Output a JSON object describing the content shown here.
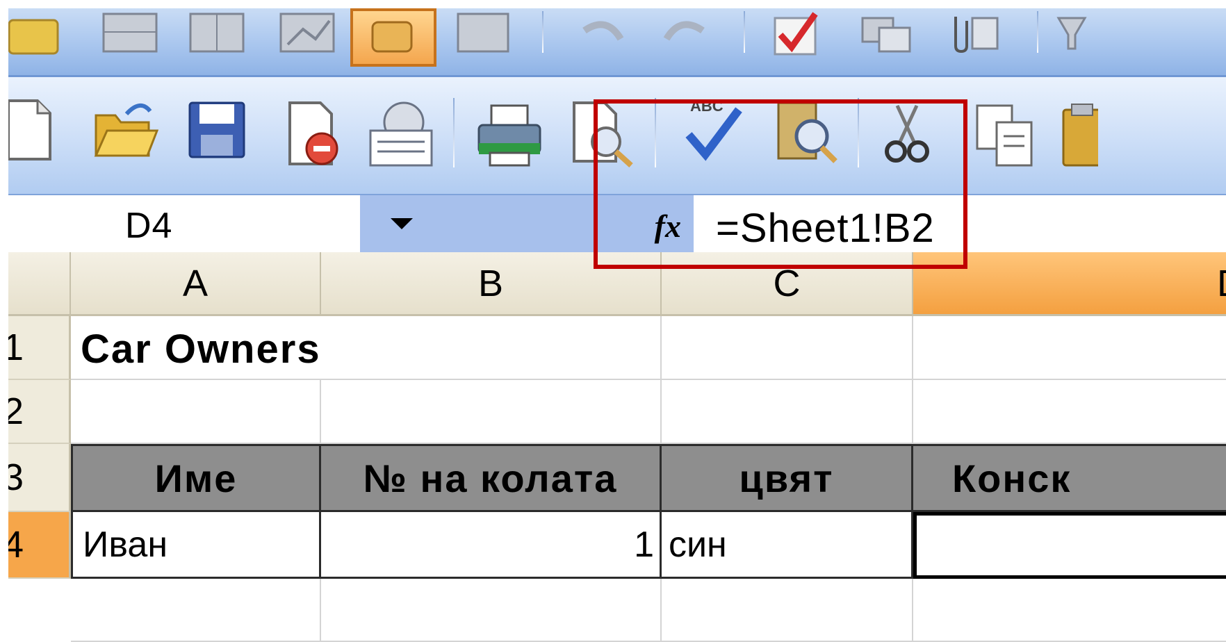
{
  "name_box": {
    "value": "D4"
  },
  "formula_bar": {
    "fx": "fx",
    "value": "=Sheet1!B2"
  },
  "columns": [
    "A",
    "B",
    "C",
    "D"
  ],
  "rows": [
    "1",
    "2",
    "3",
    "4"
  ],
  "sheet": {
    "title": "Car Owners",
    "headers": [
      "Име",
      "№ на колата",
      "цвят",
      "Конск"
    ],
    "row4": {
      "a": "Иван",
      "b": "1",
      "c": "син",
      "d": ""
    }
  },
  "colors": {
    "toolbar": "#a9c6ee",
    "selected_header": "#f4a040",
    "highlight_box": "#c00000",
    "table_header": "#8e8e8e"
  }
}
